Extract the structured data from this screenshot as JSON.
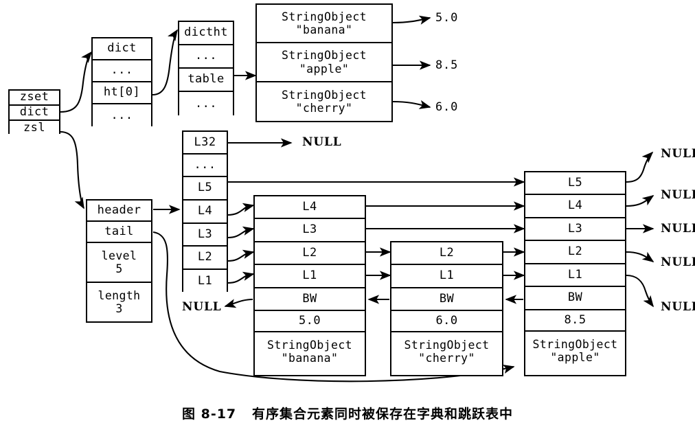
{
  "figure": {
    "caption": "图 8-17   有序集合元素同时被保存在字典和跳跃表中",
    "ink_color": "#000000",
    "background_color": "#ffffff"
  },
  "zset_struct": {
    "name": "zset",
    "rows": [
      "zset",
      "dict",
      "zsl"
    ]
  },
  "dict_struct": {
    "name": "dict",
    "rows": [
      "dict",
      "...",
      "ht[0]",
      "..."
    ]
  },
  "dictht_struct": {
    "name": "dictht",
    "rows": [
      "dictht",
      "...",
      "table",
      "..."
    ]
  },
  "hash_entries": {
    "rows": [
      {
        "object": "StringObject",
        "key": "\"banana\"",
        "score": "5.0"
      },
      {
        "object": "StringObject",
        "key": "\"apple\"",
        "score": "8.5"
      },
      {
        "object": "StringObject",
        "key": "\"cherry\"",
        "score": "6.0"
      }
    ]
  },
  "zskiplist_struct": {
    "name": "zskiplist",
    "rows": [
      {
        "label": "header",
        "value": ""
      },
      {
        "label": "tail",
        "value": ""
      },
      {
        "label": "level",
        "value": "5"
      },
      {
        "label": "length",
        "value": "3"
      }
    ]
  },
  "skiplist_header_node": {
    "name": "header-node",
    "levels": [
      "L32",
      "...",
      "L5",
      "L4",
      "L3",
      "L2",
      "L1"
    ]
  },
  "skiplist_nodes": [
    {
      "name": "banana-node",
      "levels": [
        "L4",
        "L3",
        "L2",
        "L1"
      ],
      "backward": "BW",
      "score": "5.0",
      "object": "StringObject",
      "member": "\"banana\""
    },
    {
      "name": "cherry-node",
      "levels": [
        "L2",
        "L1"
      ],
      "backward": "BW",
      "score": "6.0",
      "object": "StringObject",
      "member": "\"cherry\""
    },
    {
      "name": "apple-node",
      "levels": [
        "L5",
        "L4",
        "L3",
        "L2",
        "L1"
      ],
      "backward": "BW",
      "score": "8.5",
      "object": "StringObject",
      "member": "\"apple\""
    }
  ],
  "null_labels": {
    "header_l32": "NULL",
    "banana_backward": "NULL",
    "apple_forward": [
      "NULL",
      "NULL",
      "NULL",
      "NULL",
      "NULL"
    ]
  }
}
